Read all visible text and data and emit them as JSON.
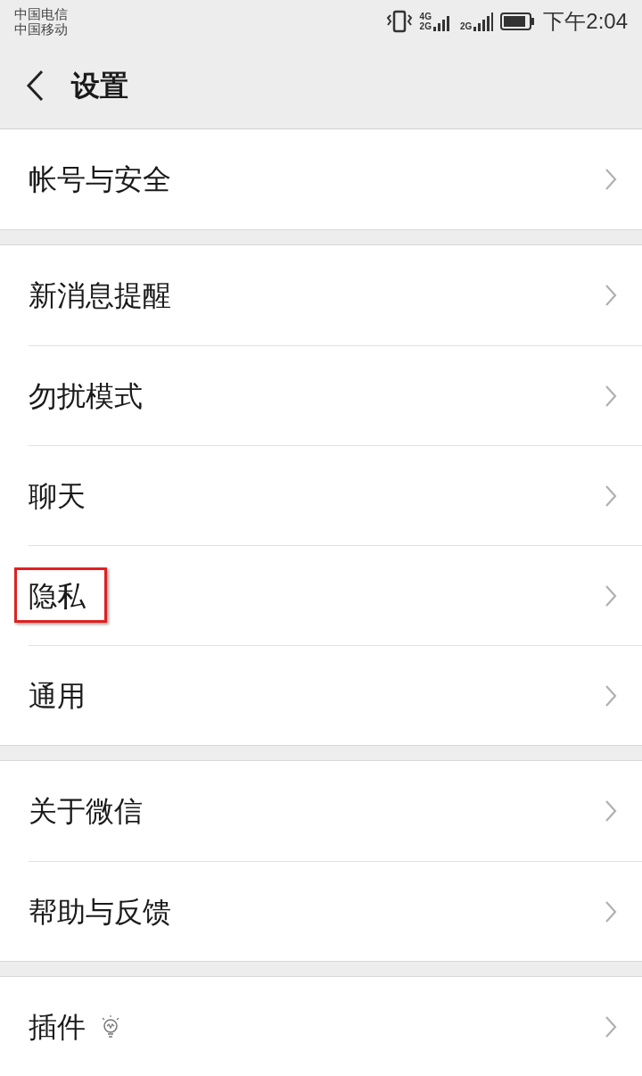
{
  "status_bar": {
    "carriers": [
      "中国电信",
      "中国移动"
    ],
    "network_labels": [
      "4G",
      "2G",
      "2G"
    ],
    "time": "下午2:04"
  },
  "header": {
    "title": "设置"
  },
  "groups": [
    {
      "items": [
        {
          "label": "帐号与安全",
          "highlighted": false,
          "kind": "plain"
        }
      ]
    },
    {
      "items": [
        {
          "label": "新消息提醒",
          "highlighted": false,
          "kind": "plain"
        },
        {
          "label": "勿扰模式",
          "highlighted": false,
          "kind": "plain"
        },
        {
          "label": "聊天",
          "highlighted": false,
          "kind": "plain"
        },
        {
          "label": "隐私",
          "highlighted": true,
          "kind": "plain"
        },
        {
          "label": "通用",
          "highlighted": false,
          "kind": "plain"
        }
      ]
    },
    {
      "items": [
        {
          "label": "关于微信",
          "highlighted": false,
          "kind": "plain"
        },
        {
          "label": "帮助与反馈",
          "highlighted": false,
          "kind": "plain"
        }
      ]
    },
    {
      "items": [
        {
          "label": "插件",
          "highlighted": false,
          "kind": "bulb"
        }
      ]
    }
  ]
}
